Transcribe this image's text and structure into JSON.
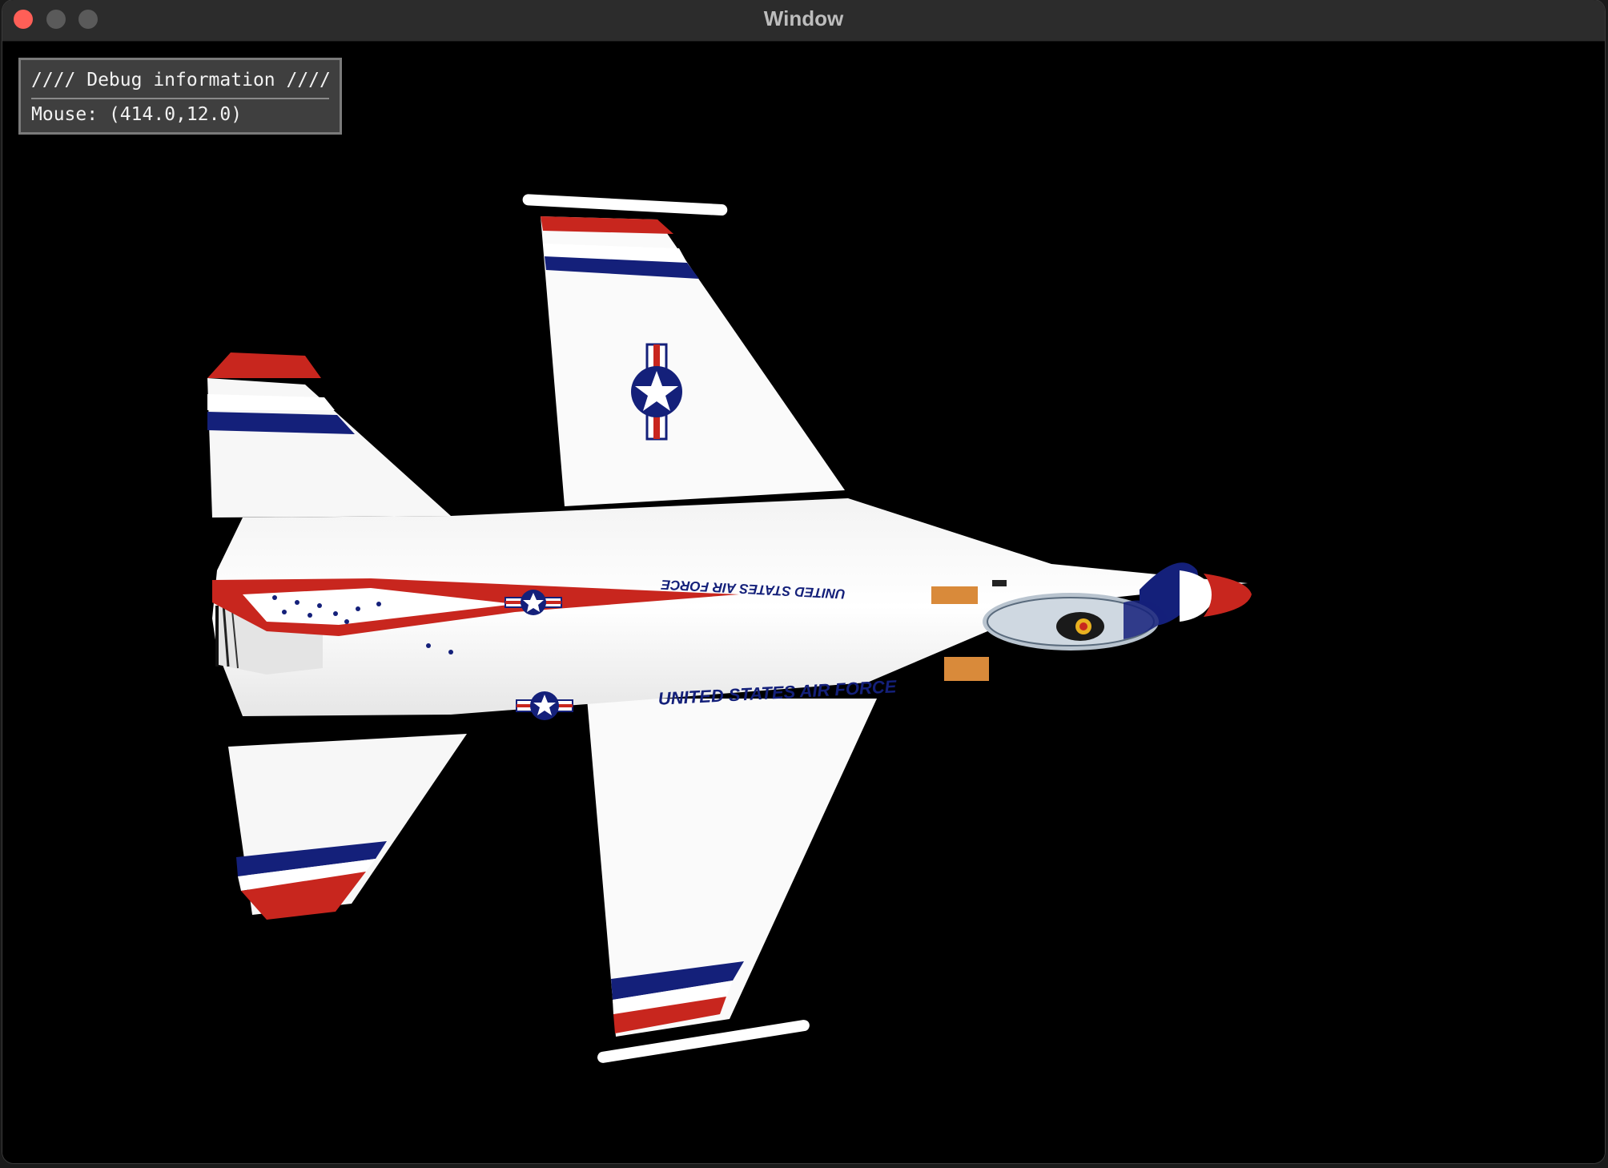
{
  "window": {
    "title": "Window"
  },
  "debug": {
    "header": "//// Debug information ////",
    "mouse_label": "Mouse:",
    "mouse_value": "(414.0,12.0)"
  },
  "scene": {
    "text_upper": "UNITED STATES AIR FORCE",
    "text_lower": "UNITED STATES AIR FORCE"
  },
  "colors": {
    "background": "#000000",
    "jet_body": "#ffffff",
    "stripe_red": "#c8261e",
    "stripe_blue": "#14207a"
  }
}
